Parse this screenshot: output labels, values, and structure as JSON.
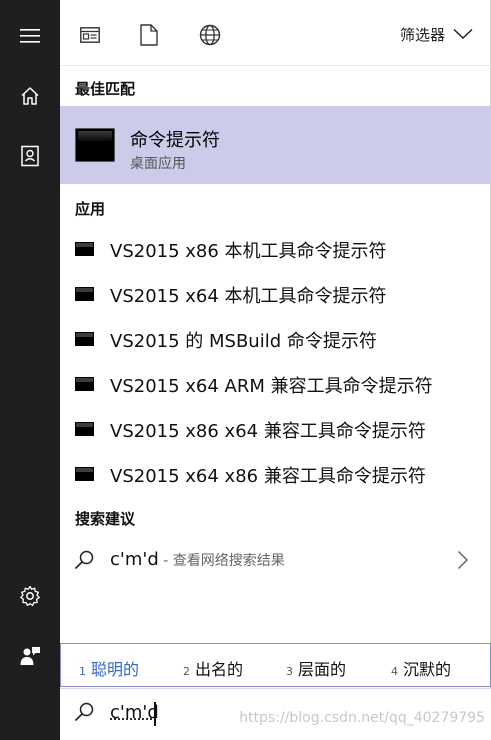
{
  "rail": {
    "items": [
      {
        "icon": "hamburger-menu-icon"
      },
      {
        "icon": "home-icon"
      },
      {
        "icon": "notebook-icon"
      },
      {
        "icon": "settings-gear-icon"
      },
      {
        "icon": "feedback-person-icon"
      }
    ]
  },
  "toolbar": {
    "icons": [
      "apps-filter-icon",
      "documents-filter-icon",
      "web-filter-icon"
    ],
    "filter_label": "筛选器"
  },
  "best_match": {
    "header": "最佳匹配",
    "title": "命令提示符",
    "subtitle": "桌面应用"
  },
  "apps": {
    "header": "应用",
    "items": [
      {
        "label": "VS2015 x86 本机工具命令提示符"
      },
      {
        "label": "VS2015 x64 本机工具命令提示符"
      },
      {
        "label": "VS2015 的 MSBuild 命令提示符"
      },
      {
        "label": "VS2015 x64 ARM 兼容工具命令提示符"
      },
      {
        "label": "VS2015 x86 x64 兼容工具命令提示符"
      },
      {
        "label": "VS2015 x64 x86 兼容工具命令提示符"
      }
    ]
  },
  "suggestions": {
    "header": "搜索建议",
    "query": "c'm'd",
    "hint": " - 查看网络搜索结果"
  },
  "ime": {
    "candidates": [
      {
        "num": "1",
        "text": "聪明的"
      },
      {
        "num": "2",
        "text": "出名的"
      },
      {
        "num": "3",
        "text": "层面的"
      },
      {
        "num": "4",
        "text": "沉默的"
      }
    ]
  },
  "search": {
    "value": "c'm'd",
    "watermark": "https://blog.csdn.net/qq_40279795"
  },
  "colors": {
    "rail_bg": "#1f1f1f",
    "selected_bg": "#ccccea",
    "ime_selected": "#3367d6"
  }
}
